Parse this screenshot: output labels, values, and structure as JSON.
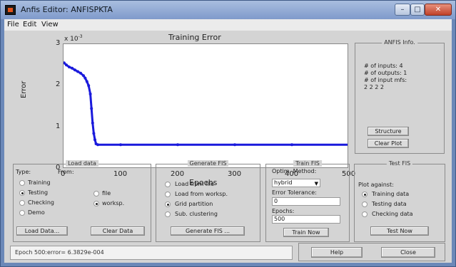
{
  "window": {
    "title": "Anfis Editor: ANFISPKTA",
    "controls": [
      "–",
      "□",
      "✕"
    ]
  },
  "menu": [
    "File",
    "Edit",
    "View"
  ],
  "chart_data": {
    "type": "line",
    "title": "Training Error",
    "xlabel": "Epochs",
    "ylabel": "Error",
    "y_exponent_label": "x 10",
    "y_exponent_power": "-3",
    "xlim": [
      0,
      500
    ],
    "ylim": [
      0,
      3
    ],
    "x_ticks": [
      "0",
      "100",
      "200",
      "300",
      "400",
      "500"
    ],
    "y_ticks": [
      "0",
      "1",
      "2",
      "3"
    ],
    "color": "#1a1adc",
    "grid": false,
    "series": [
      {
        "x": [
          1,
          5,
          10,
          15,
          20,
          25,
          30,
          35,
          38,
          41,
          44,
          47,
          49,
          51,
          53,
          55,
          57,
          60,
          100,
          200,
          300,
          400,
          500
        ],
        "y": [
          2.55,
          2.5,
          2.45,
          2.42,
          2.38,
          2.34,
          2.3,
          2.24,
          2.18,
          2.1,
          2.0,
          1.8,
          1.45,
          1.1,
          0.85,
          0.7,
          0.6,
          0.58,
          0.58,
          0.58,
          0.58,
          0.58,
          0.58
        ]
      }
    ]
  },
  "info_panel": {
    "title": "ANFIS Info.",
    "lines": [
      "# of inputs: 4",
      "# of outputs: 1",
      "# of input mfs:",
      "2 2 2 2"
    ],
    "structure_button": "Structure",
    "clear_plot_button": "Clear Plot"
  },
  "load_data": {
    "title": "Load data",
    "type_label": "Type:",
    "from_label": "From:",
    "types": [
      {
        "label": "Training",
        "selected": false
      },
      {
        "label": "Testing",
        "selected": true
      },
      {
        "label": "Checking",
        "selected": false
      },
      {
        "label": "Demo",
        "selected": false
      }
    ],
    "sources": [
      {
        "label": "file",
        "selected": false
      },
      {
        "label": "worksp.",
        "selected": true
      }
    ],
    "load_button": "Load Data...",
    "clear_button": "Clear Data"
  },
  "generate_fis": {
    "title": "Generate FIS",
    "options": [
      {
        "label": "Load from file",
        "selected": false
      },
      {
        "label": "Load from worksp.",
        "selected": false
      },
      {
        "label": "Grid partition",
        "selected": true
      },
      {
        "label": "Sub. clustering",
        "selected": false
      }
    ],
    "button": "Generate FIS ..."
  },
  "train_fis": {
    "title": "Train FIS",
    "method_label": "Optim. Method:",
    "method_value": "hybrid",
    "tolerance_label": "Error Tolerance:",
    "tolerance_value": "0",
    "epochs_label": "Epochs:",
    "epochs_value": "500",
    "button": "Train Now"
  },
  "test_fis": {
    "title": "Test FIS",
    "plot_against_label": "Plot against:",
    "options": [
      {
        "label": "Training data",
        "selected": true
      },
      {
        "label": "Testing data",
        "selected": false
      },
      {
        "label": "Checking data",
        "selected": false
      }
    ],
    "button": "Test Now"
  },
  "status_text": "Epoch 500:error= 6.3829e-004",
  "help_button": "Help",
  "close_button": "Close"
}
